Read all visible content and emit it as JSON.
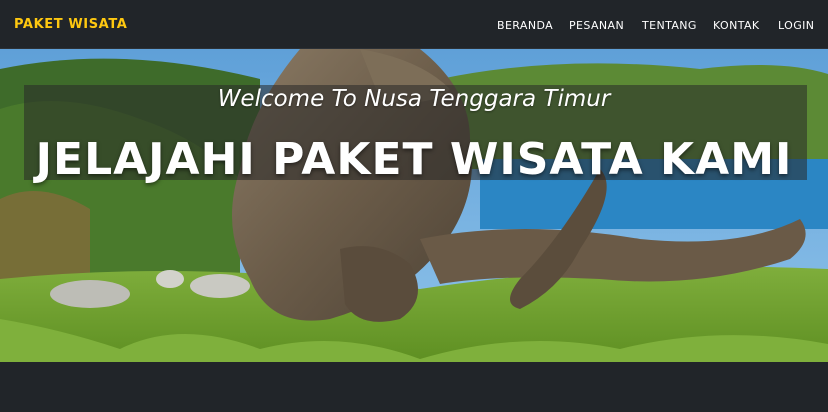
{
  "navbar": {
    "brand": "PAKET WISATA",
    "links": [
      "BERANDA",
      "PESANAN",
      "TENTANG",
      "KONTAK",
      "LOGIN"
    ]
  },
  "hero": {
    "subtitle": "Welcome To Nusa Tenggara Timur",
    "title": "JELAJAHI PAKET WISATA KAMI",
    "image": "komodo-dragon-photo"
  },
  "colors": {
    "accent": "#fec810",
    "navbar_bg": "#212529",
    "text": "#ffffff"
  }
}
